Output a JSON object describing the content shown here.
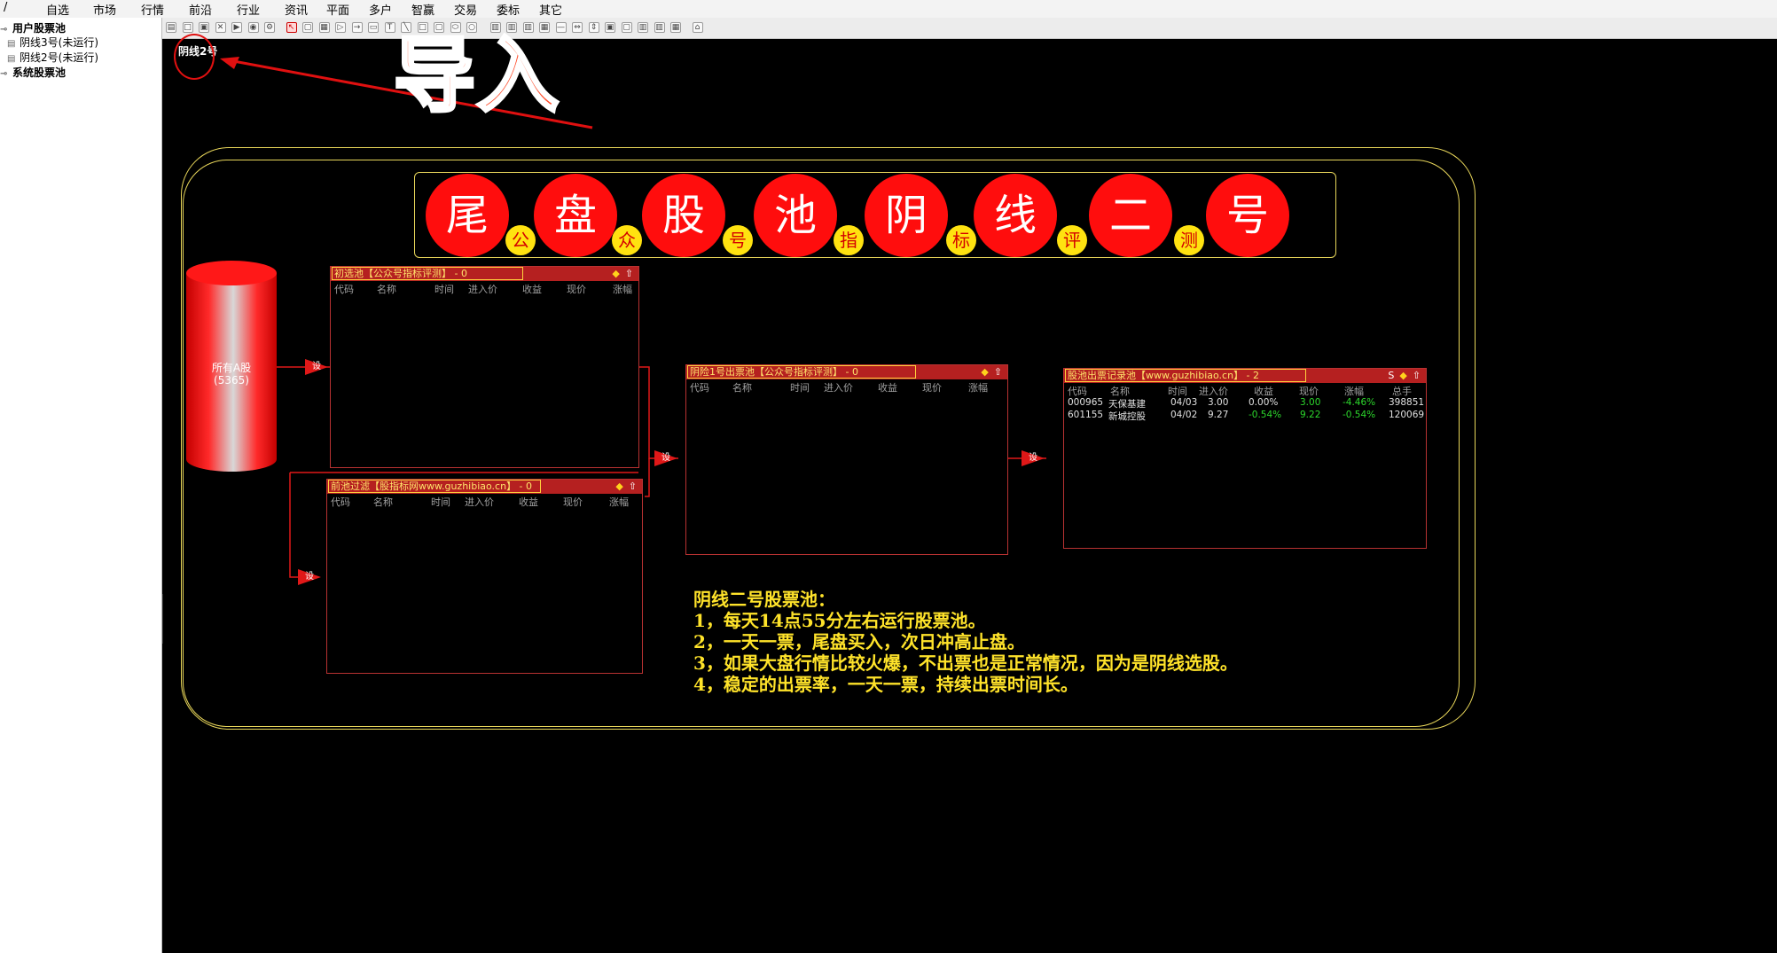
{
  "menubar": {
    "slash": "/",
    "items": [
      "自选",
      "市场",
      "行情",
      "前沿",
      "行业",
      "资讯",
      "平面",
      "多户",
      "智赢",
      "交易",
      "委标",
      "其它"
    ]
  },
  "toolbar": {
    "icons": [
      "doc-icon",
      "rectangle-icon",
      "copy-icon",
      "delete-icon",
      "play-icon",
      "record-icon",
      "settings-icon",
      "select-icon",
      "square-icon",
      "list-icon",
      "play-outline-icon",
      "arrow-right-icon",
      "window-icon",
      "text-icon",
      "line-icon",
      "rectangle-shape-icon",
      "rounded-rect-icon",
      "ellipse-icon",
      "circle-icon",
      "align-left-icon",
      "align-center-icon",
      "align-right-icon",
      "paint-icon",
      "minus-icon",
      "distribute-h-icon",
      "distribute-v-icon",
      "group-icon",
      "ungroup-icon",
      "front-icon",
      "back-icon",
      "grid-icon",
      "home-icon"
    ]
  },
  "left_tree": {
    "nodes": [
      {
        "label": "用户股票池",
        "level": 0
      },
      {
        "label": "阴线3号(未运行)",
        "level": 1
      },
      {
        "label": "阴线2号(未运行)",
        "level": 1
      },
      {
        "label": "系统股票池",
        "level": 0
      }
    ]
  },
  "canvas": {
    "strategy_label": "阴线2号",
    "annotation_text": "导入",
    "big_chars": [
      "尾",
      "盘",
      "股",
      "池",
      "阴",
      "线",
      "二",
      "号"
    ],
    "small_chars": [
      "公",
      "众",
      "号",
      "指",
      "标",
      "评",
      "测"
    ],
    "source": {
      "title": "所有A股",
      "count": "(5365)"
    },
    "set_label": "设"
  },
  "panels": {
    "pool1": {
      "title": "初选池【公众号指标评测】 - 0",
      "columns": [
        "代码",
        "名称",
        "时间",
        "进入价",
        "收益",
        "现价",
        "涨幅"
      ]
    },
    "filter": {
      "title": "前池过滤【股指标网www.guzhibiao.cn】 - 0",
      "columns": [
        "代码",
        "名称",
        "时间",
        "进入价",
        "收益",
        "现价",
        "涨幅"
      ]
    },
    "pool2": {
      "title": "阴险1号出票池【公众号指标评测】 - 0",
      "columns": [
        "代码",
        "名称",
        "时间",
        "进入价",
        "收益",
        "现价",
        "涨幅"
      ]
    },
    "record": {
      "title": "股池出票记录池【www.guzhibiao.cn】 - 2",
      "s_icon": "S",
      "columns": [
        "代码",
        "名称",
        "时间",
        "进入价",
        "收益",
        "现价",
        "涨幅",
        "总手"
      ],
      "rows": [
        {
          "code": "000965",
          "name": "天保基建",
          "time": "04/03",
          "entry": "3.00",
          "gain": "0.00%",
          "price": "3.00",
          "change": "-4.46%",
          "volume": "398851"
        },
        {
          "code": "601155",
          "name": "新城控股",
          "time": "04/02",
          "entry": "9.27",
          "gain": "-0.54%",
          "price": "9.22",
          "change": "-0.54%",
          "volume": "120069"
        }
      ]
    }
  },
  "notes": {
    "title": "阴线二号股票池：",
    "lines": [
      "1，每天14点55分左右运行股票池。",
      "2，一天一票，尾盘买入，次日冲高止盘。",
      "3，如果大盘行情比较火爆，不出票也是正常情况，因为是阴线选股。",
      "4，稳定的出票率，一天一票，持续出票时间长。"
    ]
  },
  "colors": {
    "canvas_bg": "#000000",
    "frame": "#e8d65a",
    "ball_red": "#ff0d0d",
    "ball_yellow": "#ffe210",
    "panel_title": "#b52020",
    "note_text": "#ffe32a",
    "annotation": "#ff4c2a"
  }
}
